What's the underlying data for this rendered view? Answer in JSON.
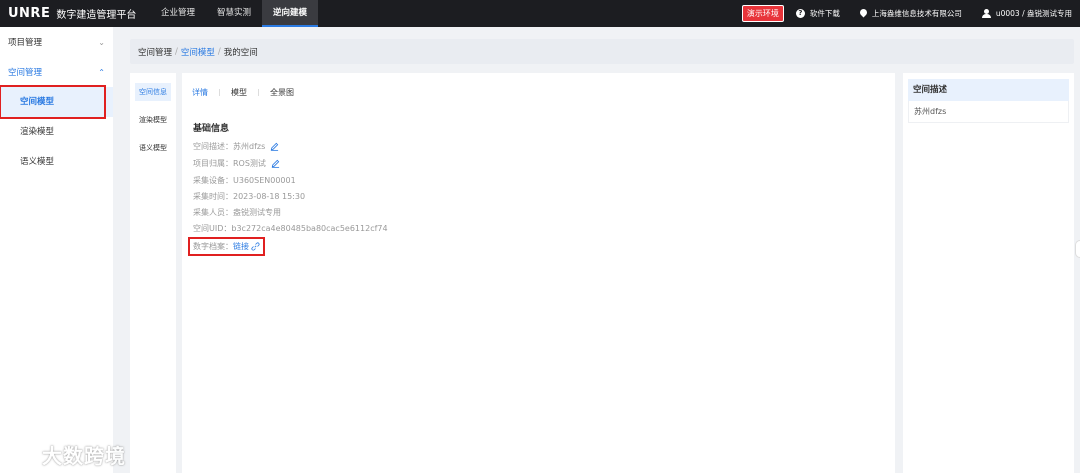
{
  "header": {
    "logo": "UNRE",
    "app_title": "数字建造管理平台",
    "nav": [
      {
        "label": "企业管理",
        "active": false
      },
      {
        "label": "智慧实测",
        "active": false
      },
      {
        "label": "逆向建模",
        "active": true
      }
    ],
    "demo_badge": "演示环境",
    "software_download": "软件下载",
    "company": "上海盎维信息技术有限公司",
    "user": "u0003 / 盎锐测试专用"
  },
  "sidebar": {
    "groups": [
      {
        "label": "项目管理",
        "open": false
      },
      {
        "label": "空间管理",
        "open": true
      }
    ],
    "items": [
      {
        "label": "空间模型",
        "active": true
      },
      {
        "label": "渲染模型",
        "active": false
      },
      {
        "label": "语义模型",
        "active": false
      }
    ]
  },
  "breadcrumb": {
    "root": "空间管理",
    "sep": "/",
    "mid": "空间模型",
    "current": "我的空间"
  },
  "mini_tabs": [
    {
      "label": "空间信息",
      "active": true
    },
    {
      "label": "渲染模型",
      "active": false
    },
    {
      "label": "语义模型",
      "active": false
    }
  ],
  "main": {
    "tabs": [
      {
        "label": "详情",
        "active": true
      },
      {
        "label": "模型",
        "active": false
      },
      {
        "label": "全景图",
        "active": false
      }
    ],
    "section_title": "基础信息",
    "fields": {
      "space_desc": {
        "label": "空间描述：",
        "value": "苏州dfzs"
      },
      "project": {
        "label": "项目归属：",
        "value": "ROS测试"
      },
      "device": {
        "label": "采集设备：",
        "value": "U360SEN00001"
      },
      "time": {
        "label": "采集时间：",
        "value": "2023-08-18 15:30"
      },
      "person": {
        "label": "采集人员：",
        "value": "盎锐测试专用"
      },
      "uid": {
        "label": "空间UID：",
        "value": "b3c272ca4e80485ba80cac5e6112cf74"
      },
      "archive": {
        "label": "数字档案：",
        "value": "链接"
      }
    }
  },
  "right_panel": {
    "title": "空间描述",
    "content": "苏州dfzs"
  },
  "watermark": "大数跨境",
  "colors": {
    "accent": "#2a7ae2",
    "topbar": "#1c1d21",
    "highlight_border": "#e02020",
    "demo_badge": "#e8343a"
  }
}
